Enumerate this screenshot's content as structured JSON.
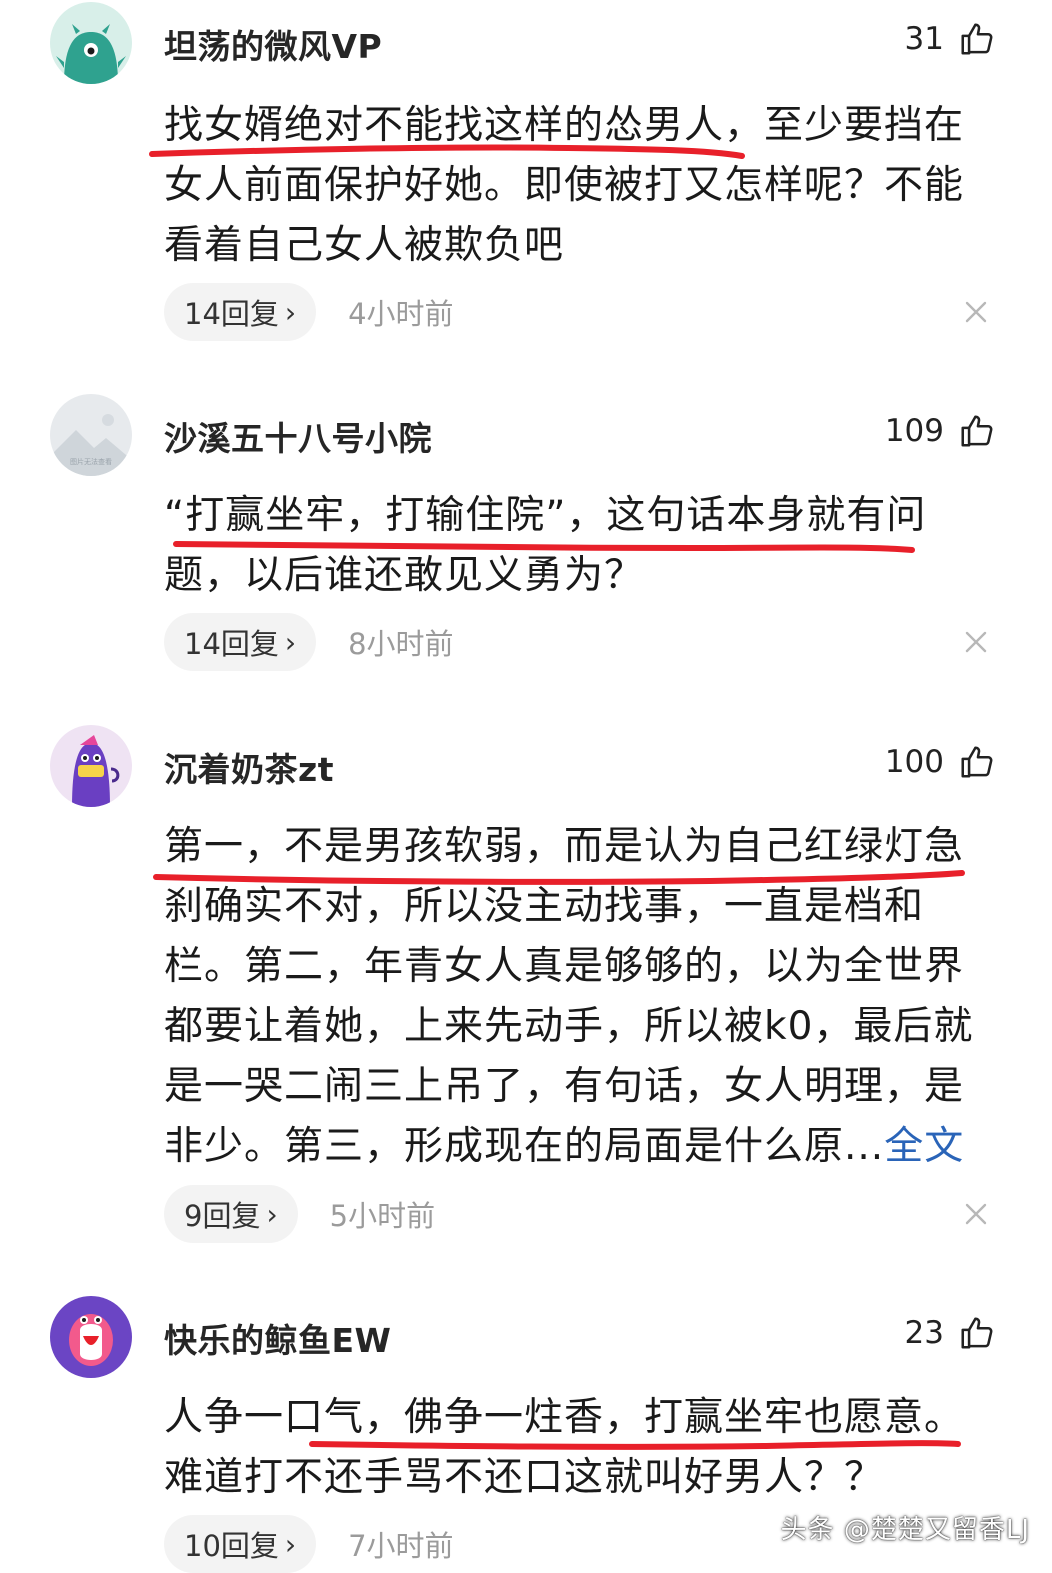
{
  "comments": [
    {
      "username": "坦荡的微风VP",
      "likes": "31",
      "lines": [
        "找女婿绝对不能找这样的怂男人，至少要挡在",
        "女人前面保护好她。即使被打又怎样呢？不能",
        "看着自己女人被欺负吧"
      ],
      "replies": "14回复",
      "time": "4小时前"
    },
    {
      "username": "沙溪五十八号小院",
      "likes": "109",
      "avatar_text": "图片无法查看",
      "lines": [
        "“打赢坐牢，打输住院”，这句话本身就有问",
        "题，以后谁还敢见义勇为？"
      ],
      "replies": "14回复",
      "time": "8小时前"
    },
    {
      "username": "沉着奶茶zt",
      "likes": "100",
      "lines": [
        "第一，不是男孩软弱，而是认为自己红绿灯急",
        "刹确实不对，所以没主动找事，一直是档和",
        "栏。第二，年青女人真是够够的，以为全世界",
        "都要让着她，上来先动手，所以被k0，最后就",
        "是一哭二闹三上吊了，有句话，女人明理，是",
        "非少。第三，形成现在的局面是什么原..."
      ],
      "full_text_link": "全文",
      "replies": "9回复",
      "time": "5小时前"
    },
    {
      "username": "快乐的鲸鱼EW",
      "likes": "23",
      "lines": [
        "人争一口气，佛争一炷香，打赢坐牢也愿意。",
        "难道打不还手骂不还口这就叫好男人？？"
      ],
      "replies": "10回复",
      "time": "7小时前"
    }
  ],
  "watermark": "头条 @楚楚又留香LJ",
  "colors": {
    "underline": "#e8202a",
    "link": "#2a64b8",
    "pill_bg": "#f3f3f3",
    "meta_text": "#9b9b9b"
  }
}
